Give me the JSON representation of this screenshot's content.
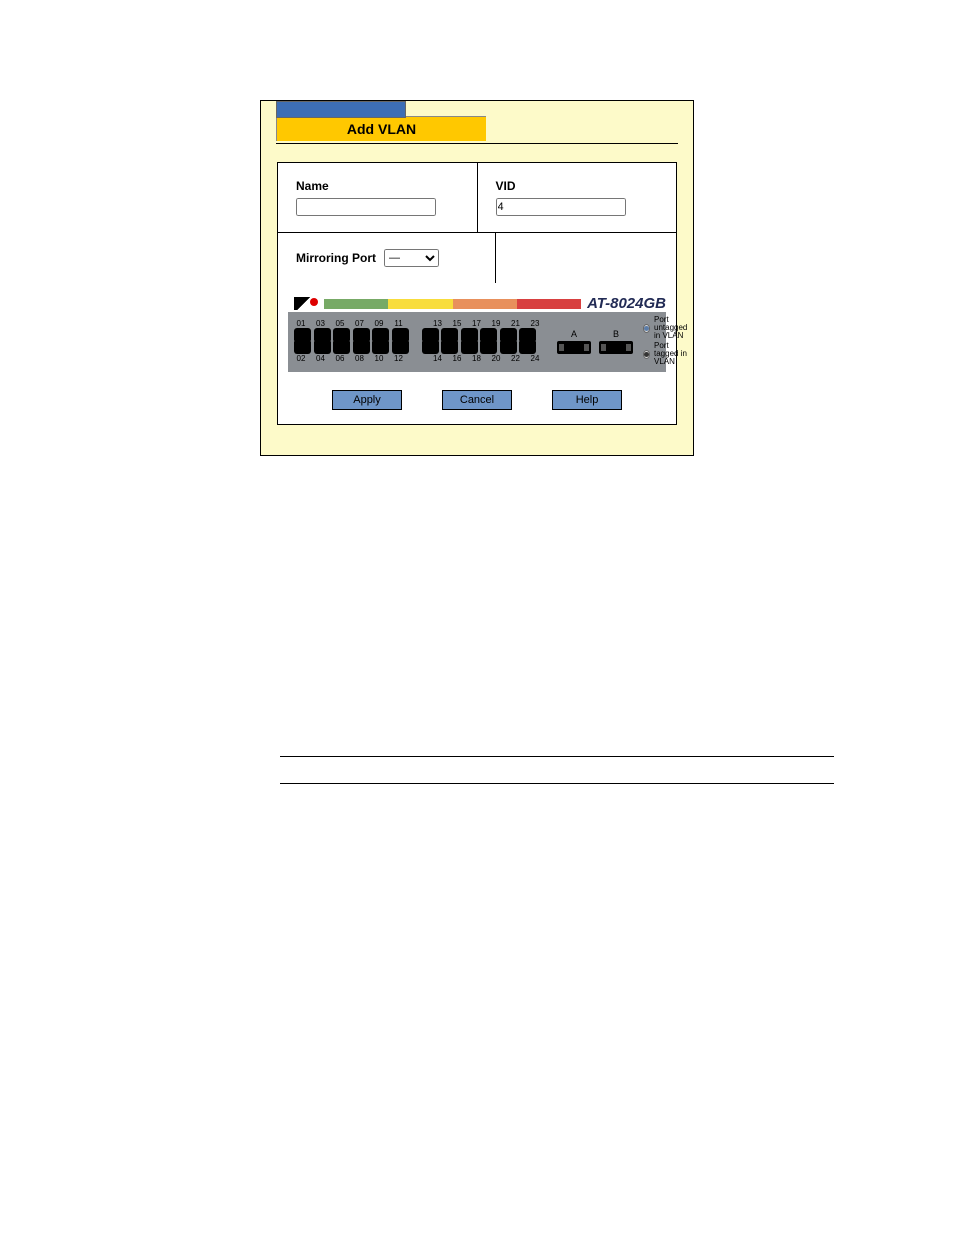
{
  "title": "Add VLAN",
  "fields": {
    "name": {
      "label": "Name",
      "value": ""
    },
    "vid": {
      "label": "VID",
      "value": "4"
    },
    "mirroring": {
      "label": "Mirroring Port",
      "value": "—"
    }
  },
  "device": {
    "model": "AT-8024GB"
  },
  "ports": {
    "top": [
      "01",
      "03",
      "05",
      "07",
      "09",
      "11",
      "13",
      "15",
      "17",
      "19",
      "21",
      "23"
    ],
    "bottom": [
      "02",
      "04",
      "06",
      "08",
      "10",
      "12",
      "14",
      "16",
      "18",
      "20",
      "22",
      "24"
    ],
    "uplinks": [
      "A",
      "B"
    ]
  },
  "legend": {
    "untagged": "Port untagged in VLAN",
    "tagged": "Port tagged in VLAN"
  },
  "buttons": {
    "apply": "Apply",
    "cancel": "Cancel",
    "help": "Help"
  }
}
